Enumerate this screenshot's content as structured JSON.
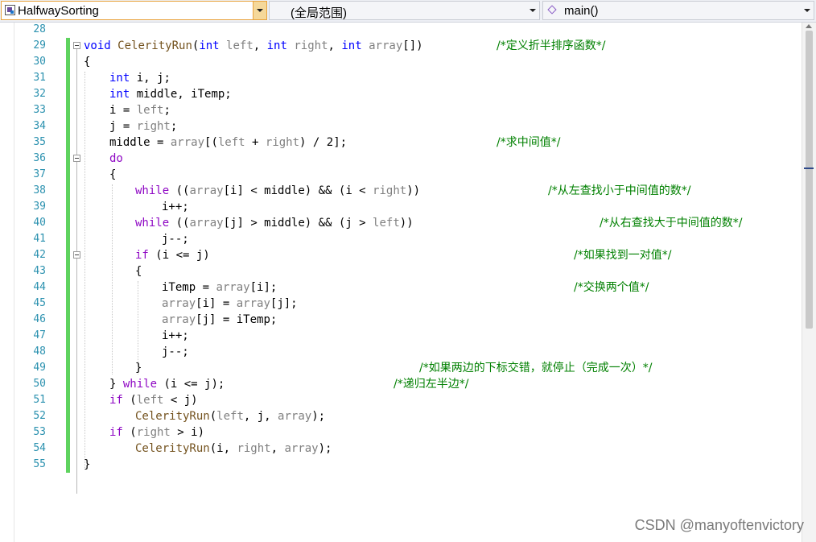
{
  "toolbar": {
    "file_combo": "HalfwaySorting",
    "scope_combo": "(全局范围)",
    "function_combo": "main()"
  },
  "editor": {
    "line_numbers": [
      "28",
      "29",
      "30",
      "31",
      "32",
      "33",
      "34",
      "35",
      "36",
      "37",
      "38",
      "39",
      "40",
      "41",
      "42",
      "43",
      "44",
      "45",
      "46",
      "47",
      "48",
      "49",
      "50",
      "51",
      "52",
      "53",
      "54",
      "55"
    ],
    "comments": {
      "c29": "/*定义折半排序函数*/",
      "c35": "/*求中间值*/",
      "c38": "/*从左查找小于中间值的数*/",
      "c40": "/*从右查找大于中间值的数*/",
      "c42": "/*如果找到一对值*/",
      "c44": "/*交换两个值*/",
      "c49": "/*如果两边的下标交错，就停止（完成一次）*/",
      "c50": "/*递归左半边*/"
    }
  },
  "watermark": "CSDN @manyoftenvictory",
  "colors": {
    "keyword": "#0000ff",
    "control_keyword": "#8f08c4",
    "comment": "#008000",
    "parameter": "#808080",
    "function": "#74531f",
    "line_number": "#2b91af",
    "change_bar": "#5fd35f"
  }
}
